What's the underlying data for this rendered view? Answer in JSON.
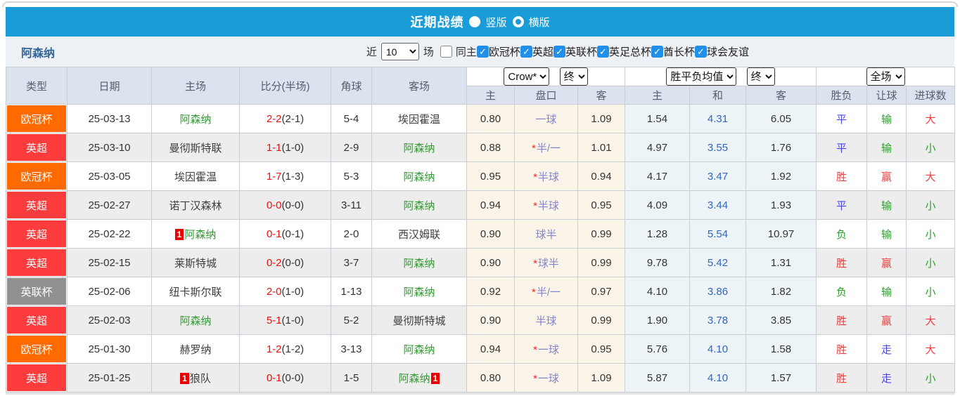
{
  "title_bar": {
    "title": "近期战绩",
    "radio_vertical": "竖版",
    "radio_horizontal": "横版"
  },
  "filter_bar": {
    "team": "阿森纳",
    "recent_label": "近",
    "recent_value": "10",
    "matches_label": "场",
    "same_home_label": "同主",
    "competitions": [
      "欧冠杯",
      "英超",
      "英联杯",
      "英足总杯",
      "酋长杯",
      "球会友谊"
    ]
  },
  "table": {
    "headers": {
      "type": "类型",
      "date": "日期",
      "home": "主场",
      "score": "比分(半场)",
      "corner": "角球",
      "away": "客场",
      "odds_sub_home": "主",
      "odds_sub_line": "盘口",
      "odds_sub_away": "客",
      "avg_sub_home": "主",
      "avg_sub_draw": "和",
      "avg_sub_away": "客",
      "res_sub_wdl": "胜负",
      "res_sub_handicap": "让球",
      "res_sub_goals": "进球数"
    },
    "selects": {
      "bookmaker": "Crow*",
      "odds_time": "终",
      "avg_label": "胜平负均值",
      "avg_time": "终",
      "scope": "全场"
    },
    "rows": [
      {
        "league": "欧冠杯",
        "league_color": "league_ucl",
        "date": "25-03-13",
        "home": "阿森纳",
        "home_self": true,
        "home_badge": "",
        "score_ft": "2-2",
        "score_ht": "(2-1)",
        "corner": "5-4",
        "away": "埃因霍温",
        "away_self": false,
        "away_badge": "",
        "odds_home": "0.80",
        "handicap_star": false,
        "handicap": "一球",
        "odds_away": "1.09",
        "avg_home": "1.54",
        "avg_draw": "4.31",
        "avg_away": "6.05",
        "res_wdl": "平",
        "res_wdl_color": "res_blue",
        "res_handicap": "输",
        "res_handicap_color": "res_green",
        "res_goals": "大",
        "res_goals_color": "res_red"
      },
      {
        "league": "英超",
        "league_color": "league_epl",
        "date": "25-03-10",
        "home": "曼彻斯特联",
        "home_self": false,
        "home_badge": "",
        "score_ft": "1-1",
        "score_ht": "(1-0)",
        "corner": "2-9",
        "away": "阿森纳",
        "away_self": true,
        "away_badge": "",
        "odds_home": "0.88",
        "handicap_star": true,
        "handicap": "半/一",
        "odds_away": "1.01",
        "avg_home": "4.97",
        "avg_draw": "3.55",
        "avg_away": "1.76",
        "res_wdl": "平",
        "res_wdl_color": "res_blue",
        "res_handicap": "输",
        "res_handicap_color": "res_green",
        "res_goals": "小",
        "res_goals_color": "res_green"
      },
      {
        "league": "欧冠杯",
        "league_color": "league_ucl",
        "date": "25-03-05",
        "home": "埃因霍温",
        "home_self": false,
        "home_badge": "",
        "score_ft": "1-7",
        "score_ht": "(1-3)",
        "corner": "5-3",
        "away": "阿森纳",
        "away_self": true,
        "away_badge": "",
        "odds_home": "0.95",
        "handicap_star": true,
        "handicap": "半球",
        "odds_away": "0.94",
        "avg_home": "4.17",
        "avg_draw": "3.47",
        "avg_away": "1.92",
        "res_wdl": "胜",
        "res_wdl_color": "res_red",
        "res_handicap": "赢",
        "res_handicap_color": "res_red",
        "res_goals": "大",
        "res_goals_color": "res_red"
      },
      {
        "league": "英超",
        "league_color": "league_epl",
        "date": "25-02-27",
        "home": "诺丁汉森林",
        "home_self": false,
        "home_badge": "",
        "score_ft": "0-0",
        "score_ht": "(0-0)",
        "corner": "3-11",
        "away": "阿森纳",
        "away_self": true,
        "away_badge": "",
        "odds_home": "0.94",
        "handicap_star": true,
        "handicap": "半球",
        "odds_away": "0.95",
        "avg_home": "4.09",
        "avg_draw": "3.44",
        "avg_away": "1.93",
        "res_wdl": "平",
        "res_wdl_color": "res_blue",
        "res_handicap": "输",
        "res_handicap_color": "res_green",
        "res_goals": "小",
        "res_goals_color": "res_green"
      },
      {
        "league": "英超",
        "league_color": "league_epl",
        "date": "25-02-22",
        "home": "阿森纳",
        "home_self": true,
        "home_badge": "1",
        "score_ft": "0-1",
        "score_ht": "(0-1)",
        "corner": "2-0",
        "away": "西汉姆联",
        "away_self": false,
        "away_badge": "",
        "odds_home": "0.90",
        "handicap_star": false,
        "handicap": "球半",
        "odds_away": "0.99",
        "avg_home": "1.28",
        "avg_draw": "5.54",
        "avg_away": "10.97",
        "res_wdl": "负",
        "res_wdl_color": "res_green",
        "res_handicap": "输",
        "res_handicap_color": "res_green",
        "res_goals": "小",
        "res_goals_color": "res_green"
      },
      {
        "league": "英超",
        "league_color": "league_epl",
        "date": "25-02-15",
        "home": "莱斯特城",
        "home_self": false,
        "home_badge": "",
        "score_ft": "0-2",
        "score_ht": "(0-0)",
        "corner": "3-7",
        "away": "阿森纳",
        "away_self": true,
        "away_badge": "",
        "odds_home": "0.90",
        "handicap_star": true,
        "handicap": "球半",
        "odds_away": "0.99",
        "avg_home": "9.78",
        "avg_draw": "5.42",
        "avg_away": "1.31",
        "res_wdl": "胜",
        "res_wdl_color": "res_red",
        "res_handicap": "赢",
        "res_handicap_color": "res_red",
        "res_goals": "小",
        "res_goals_color": "res_green"
      },
      {
        "league": "英联杯",
        "league_color": "league_efl",
        "date": "25-02-06",
        "home": "纽卡斯尔联",
        "home_self": false,
        "home_badge": "",
        "score_ft": "2-0",
        "score_ht": "(1-0)",
        "corner": "1-13",
        "away": "阿森纳",
        "away_self": true,
        "away_badge": "",
        "odds_home": "0.92",
        "handicap_star": true,
        "handicap": "半/一",
        "odds_away": "0.97",
        "avg_home": "4.10",
        "avg_draw": "3.86",
        "avg_away": "1.82",
        "res_wdl": "负",
        "res_wdl_color": "res_green",
        "res_handicap": "输",
        "res_handicap_color": "res_green",
        "res_goals": "小",
        "res_goals_color": "res_green"
      },
      {
        "league": "英超",
        "league_color": "league_epl",
        "date": "25-02-03",
        "home": "阿森纳",
        "home_self": true,
        "home_badge": "",
        "score_ft": "5-1",
        "score_ht": "(1-0)",
        "corner": "5-2",
        "away": "曼彻斯特城",
        "away_self": false,
        "away_badge": "",
        "odds_home": "0.90",
        "handicap_star": false,
        "handicap": "半球",
        "odds_away": "0.99",
        "avg_home": "1.90",
        "avg_draw": "3.78",
        "avg_away": "3.85",
        "res_wdl": "胜",
        "res_wdl_color": "res_red",
        "res_handicap": "赢",
        "res_handicap_color": "res_red",
        "res_goals": "大",
        "res_goals_color": "res_red"
      },
      {
        "league": "欧冠杯",
        "league_color": "league_ucl",
        "date": "25-01-30",
        "home": "赫罗纳",
        "home_self": false,
        "home_badge": "",
        "score_ft": "1-2",
        "score_ht": "(1-2)",
        "corner": "3-13",
        "away": "阿森纳",
        "away_self": true,
        "away_badge": "",
        "odds_home": "0.94",
        "handicap_star": true,
        "handicap": "一球",
        "odds_away": "0.95",
        "avg_home": "5.76",
        "avg_draw": "4.10",
        "avg_away": "1.58",
        "res_wdl": "胜",
        "res_wdl_color": "res_red",
        "res_handicap": "走",
        "res_handicap_color": "res_blue",
        "res_goals": "大",
        "res_goals_color": "res_red"
      },
      {
        "league": "英超",
        "league_color": "league_epl",
        "date": "25-01-25",
        "home": "狼队",
        "home_self": false,
        "home_badge": "1",
        "score_ft": "0-1",
        "score_ht": "(0-0)",
        "corner": "1-5",
        "away": "阿森纳",
        "away_self": true,
        "away_badge": "1",
        "odds_home": "0.80",
        "handicap_star": true,
        "handicap": "一球",
        "odds_away": "1.09",
        "avg_home": "5.87",
        "avg_draw": "4.10",
        "avg_away": "1.57",
        "res_wdl": "胜",
        "res_wdl_color": "res_red",
        "res_handicap": "走",
        "res_handicap_color": "res_blue",
        "res_goals": "小",
        "res_goals_color": "res_green"
      }
    ]
  },
  "colors": {
    "header_bar_bg": "#1a9cd8",
    "league_ucl": "#ff6a00",
    "league_epl": "#fd3d3d",
    "league_efl": "#909090",
    "self_team_green": "#339933",
    "score_red": "#ee1111",
    "handicap_text": "#8585cc",
    "star_red": "#ff2222",
    "avg_draw_blue": "#3366bb",
    "res_red": "#f03b3b",
    "res_green": "#2f9e2f",
    "res_blue": "#4848e8",
    "badge_red": "#e80000"
  }
}
